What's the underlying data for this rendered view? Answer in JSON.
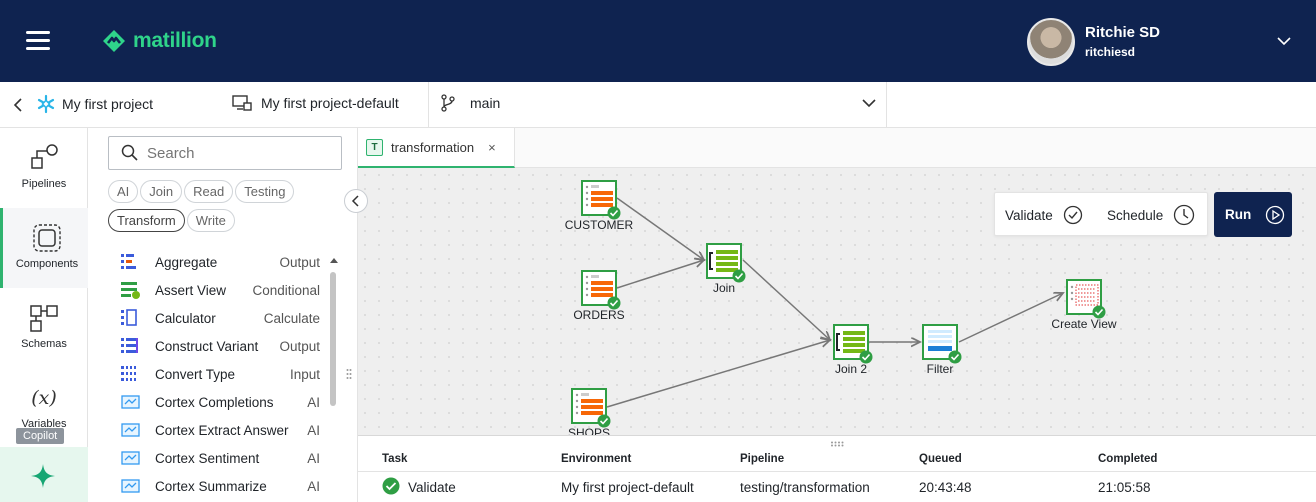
{
  "header": {
    "logo_text": "matillion",
    "user_name": "Ritchie SD",
    "user_handle": "ritchiesd",
    "brand_color": "#0f2350",
    "accent_color": "#2fd48a"
  },
  "breadcrumb": {
    "project": "My first project",
    "environment": "My first project-default",
    "branch": "main"
  },
  "rail": {
    "items": [
      {
        "label": "Pipelines",
        "icon": "pipelines-icon"
      },
      {
        "label": "Components",
        "icon": "components-icon"
      },
      {
        "label": "Schemas",
        "icon": "schemas-icon"
      },
      {
        "label": "Variables",
        "icon": "variables-icon"
      }
    ],
    "copilot_tooltip": "Copilot"
  },
  "panel": {
    "search_placeholder": "Search",
    "chips": [
      "AI",
      "Join",
      "Read",
      "Testing",
      "Transform",
      "Write"
    ],
    "selected_chip": "Transform",
    "components": [
      {
        "name": "Aggregate",
        "category": "Output"
      },
      {
        "name": "Assert View",
        "category": "Conditional"
      },
      {
        "name": "Calculator",
        "category": "Calculate"
      },
      {
        "name": "Construct Variant",
        "category": "Output"
      },
      {
        "name": "Convert Type",
        "category": "Input"
      },
      {
        "name": "Cortex Completions",
        "category": "AI"
      },
      {
        "name": "Cortex Extract Answer",
        "category": "AI"
      },
      {
        "name": "Cortex Sentiment",
        "category": "AI"
      },
      {
        "name": "Cortex Summarize",
        "category": "AI"
      }
    ]
  },
  "tab": {
    "badge": "T",
    "label": "transformation",
    "close": "×"
  },
  "canvas": {
    "nodes": [
      "CUSTOMER",
      "ORDERS",
      "SHOPS",
      "Join",
      "Join 2",
      "Filter",
      "Create View"
    ],
    "validate_label": "Validate",
    "schedule_label": "Schedule",
    "run_label": "Run"
  },
  "tasks": {
    "columns": [
      "Task",
      "Environment",
      "Pipeline",
      "Queued",
      "Completed"
    ],
    "rows": [
      {
        "task": "Validate",
        "environment": "My first project-default",
        "pipeline": "testing/transformation",
        "queued": "20:43:48",
        "completed": "21:05:58"
      }
    ]
  }
}
